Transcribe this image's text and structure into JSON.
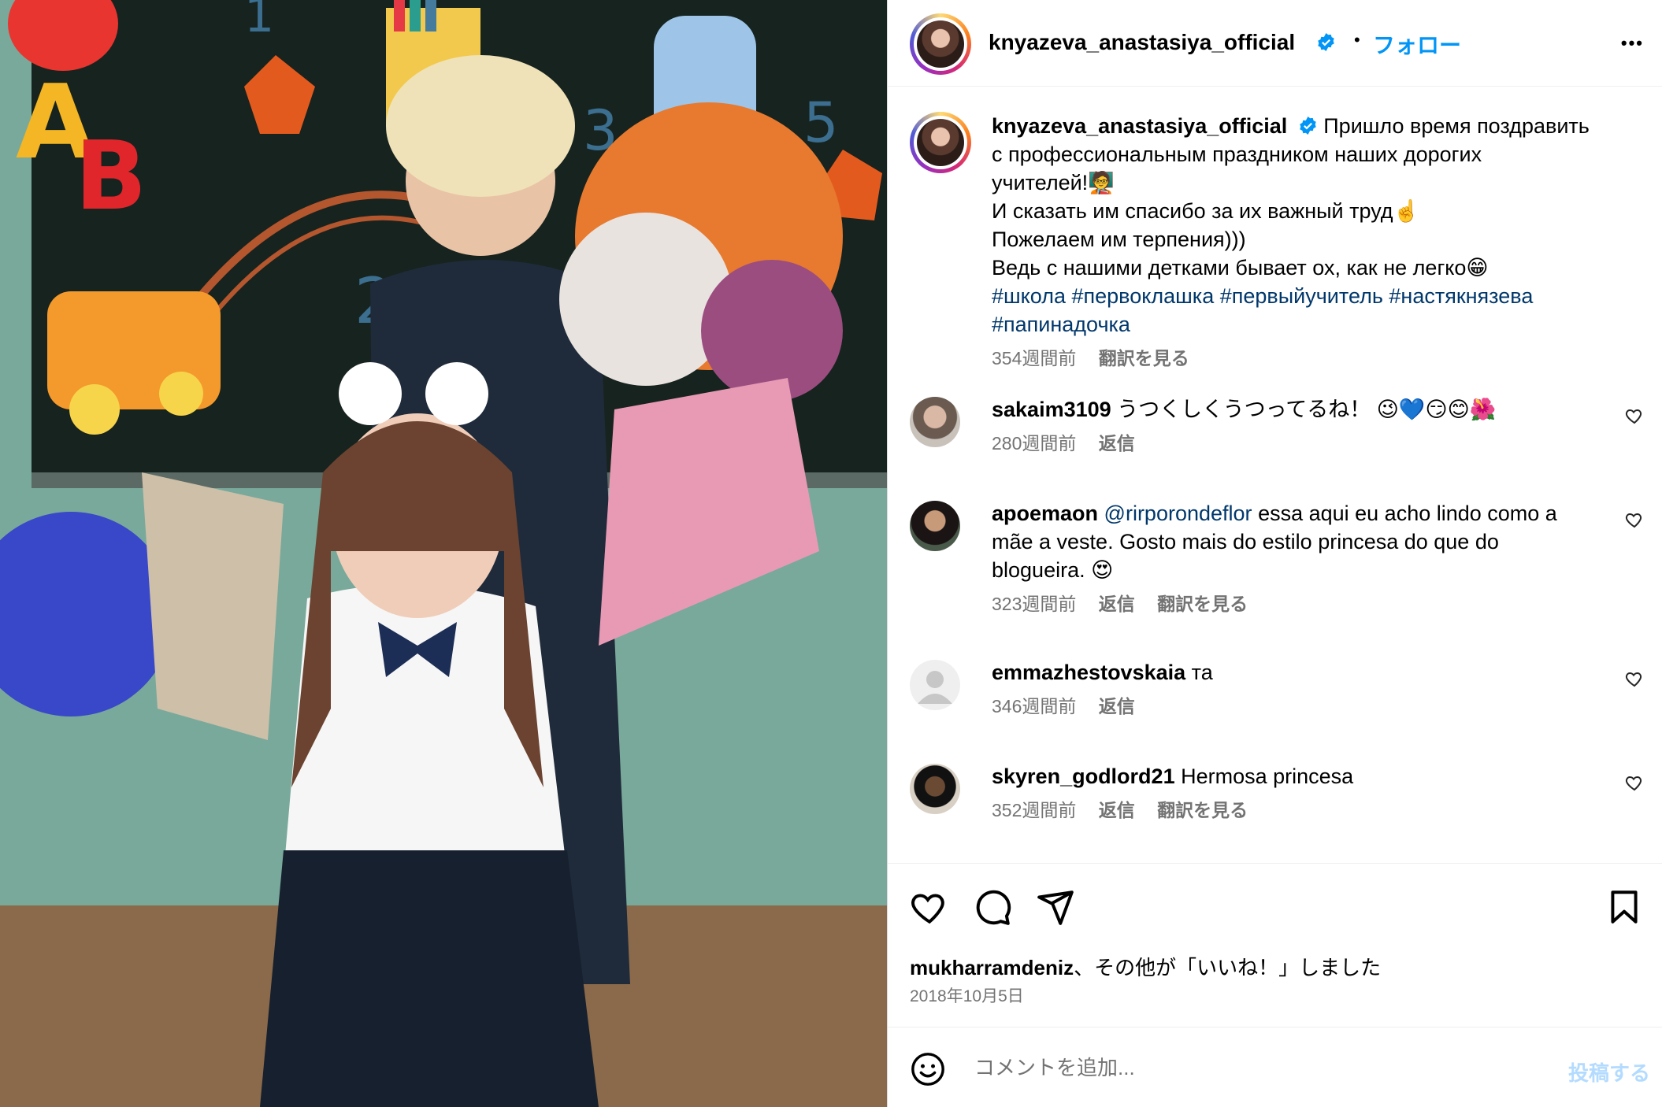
{
  "post": {
    "author": "knyazeva_anastasiya_official",
    "follow_label": "フォロー",
    "separator": "•",
    "more_label": "•••",
    "photo_alt": "photo",
    "caption": {
      "lines": [
        "Пришло время поздравить",
        "с профессиональным праздником наших дорогих",
        "учителей!🧑‍🏫",
        "И сказать им спасибо за их важный труд☝️",
        "Пожелаем им терпения)))",
        "Ведь с нашими детками бывает ох, как не легко😁"
      ],
      "hashtags": [
        "#школа",
        "#первоклашка",
        "#первыйучитель",
        "#настякнязева",
        "#папинадочка"
      ],
      "time": "354週間前",
      "translate_label": "翻訳を見る"
    },
    "comments": [
      {
        "username": "sakaim3109",
        "text": "うつくしくうつってるね！ 😉💙😏😊🌺",
        "time": "280週間前",
        "reply_label": "返信",
        "translate_label": ""
      },
      {
        "username": "apoemaon",
        "mention": "@rirporondeflor",
        "text": "essa aqui eu acho lindo como a mãe a veste. Gosto mais do estilo princesa do que do blogueira. 😍",
        "time": "323週間前",
        "reply_label": "返信",
        "translate_label": "翻訳を見る"
      },
      {
        "username": "emmazhestovskaia",
        "text": "та",
        "time": "346週間前",
        "reply_label": "返信",
        "translate_label": ""
      },
      {
        "username": "skyren_godlord21",
        "text": "Hermosa princesa",
        "time": "352週間前",
        "reply_label": "返信",
        "translate_label": "翻訳を見る"
      }
    ],
    "likes": {
      "user": "mukharramdeniz",
      "suffix": "、その他が「いいね！」しました"
    },
    "date": "2018年10月5日",
    "add_comment": {
      "placeholder": "コメントを追加...",
      "post_label": "投稿する"
    }
  },
  "colors": {
    "accent": "#0095f6",
    "hashtag": "#00376b",
    "muted": "#737373",
    "post_disabled": "#b3dbff"
  },
  "icons": [
    "verified-badge-icon",
    "heart-icon",
    "comment-icon",
    "share-icon",
    "bookmark-icon",
    "emoji-icon",
    "more-icon"
  ]
}
